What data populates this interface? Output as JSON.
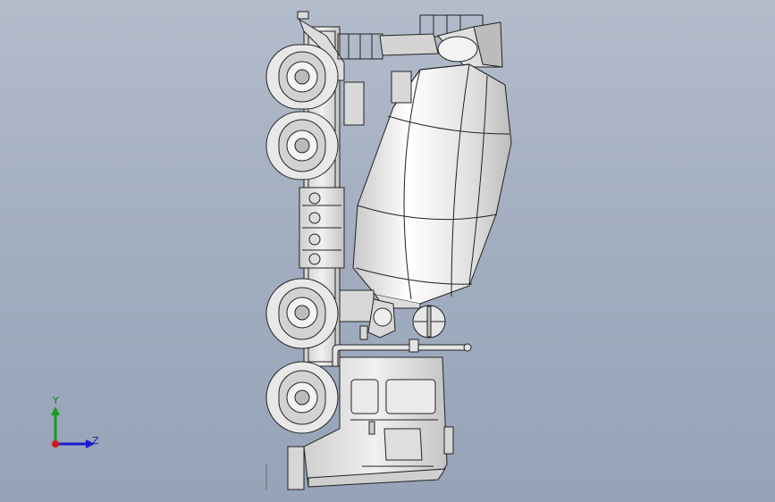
{
  "viewport": {
    "background_top": "#b3bccb",
    "background_bottom": "#96a3b8",
    "model": "concrete-mixer-truck",
    "view": "top view"
  },
  "triad": {
    "y_label": "Y",
    "z_label": "Z",
    "y_color": "#1a9a1a",
    "z_color": "#1a1ad0",
    "x_color": "#d01a1a"
  },
  "colors": {
    "body_fill": "#d9d9d9",
    "drum_fill": "#e8e8e8",
    "line": "#222222",
    "tire_fill": "#e6e6e6"
  }
}
